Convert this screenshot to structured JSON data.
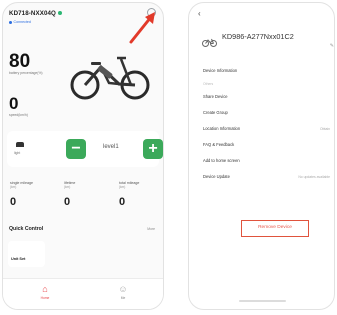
{
  "left_screen": {
    "device_title": "KD718-NXX04Q",
    "connection_status": "Connected",
    "battery": {
      "value": "80",
      "label": "battery percentage(%)"
    },
    "speed": {
      "value": "0",
      "label": "speed(km/h)"
    },
    "controls": {
      "light_label": "light",
      "minus_label": "−",
      "level_text": "level1",
      "plus_label": "+"
    },
    "mileage": [
      {
        "label": "single mileage",
        "unit": "(km)",
        "value": "0"
      },
      {
        "label": "lifetime",
        "unit": "(km)",
        "value": "0"
      },
      {
        "label": "total mileage",
        "unit": "(km)",
        "value": "0"
      }
    ],
    "quick_control": {
      "title": "Quick Control",
      "more": "More",
      "card_label": "Unit Set"
    },
    "tabs": [
      {
        "icon": "home-icon",
        "label": "Home"
      },
      {
        "icon": "profile-icon",
        "label": "Me"
      }
    ]
  },
  "right_screen": {
    "back": "‹",
    "device_title": "KD986-A277Nxx01C2",
    "menu": [
      {
        "label": "Device Information",
        "value": ""
      },
      {
        "label": "Others",
        "value": "",
        "section": true
      },
      {
        "label": "Share Device",
        "value": ""
      },
      {
        "label": "Create Group",
        "value": ""
      },
      {
        "label": "Location Information",
        "value": "Obtain"
      },
      {
        "label": "FAQ & Feedback",
        "value": ""
      },
      {
        "label": "Add to home screen",
        "value": ""
      },
      {
        "label": "Device Update",
        "value": "No updates available"
      }
    ],
    "remove_label": "Remove Device"
  },
  "colors": {
    "accent_green": "#3ba95a",
    "remove_red": "#e8574b",
    "annotation_red": "#e23a2a",
    "link_blue": "#2b6de0"
  }
}
